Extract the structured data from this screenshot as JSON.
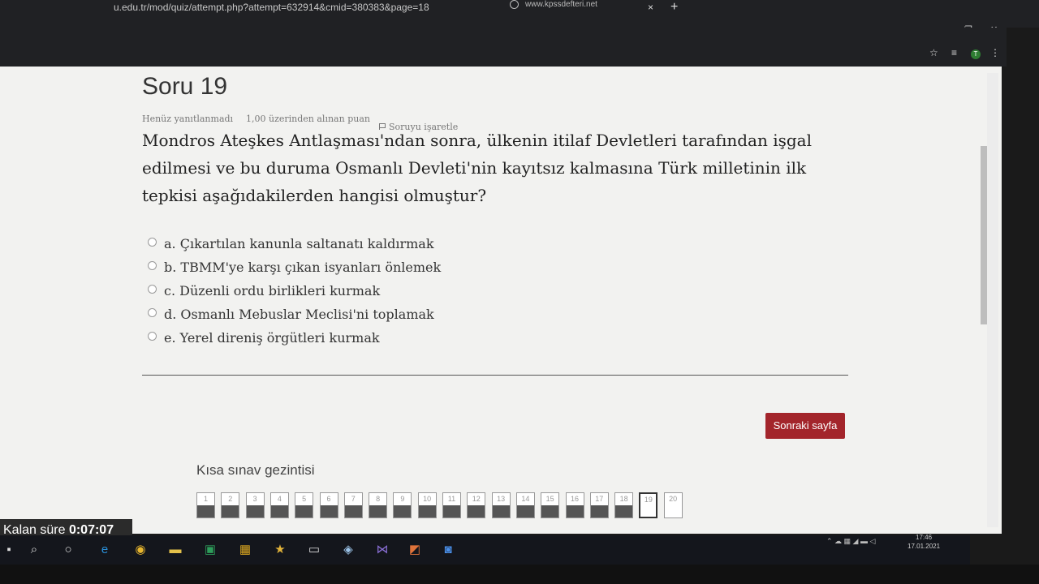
{
  "browser": {
    "url": "mod/quiz/attempt.php?attempt=632914&cmid=380383&page=18",
    "url_prefix": "u.edu.tr/",
    "tab_title": "www.kpssdefteri.net",
    "tab_close": "×",
    "new_tab": "+",
    "window_controls": [
      "–",
      "❐",
      "✕"
    ],
    "toolbar_icons": [
      "star-icon",
      "reading-list-icon",
      "profile-avatar",
      "menu-icon"
    ],
    "avatar_letter": "T"
  },
  "quiz": {
    "title": "Soru 19",
    "status": "Henüz yanıtlanmadı",
    "points": "1,00 üzerinden alınan puan",
    "flag_label": "Soruyu işaretle",
    "question_text": "Mondros Ateşkes Antlaşması'ndan sonra, ülkenin itilaf Devletleri tarafından işgal edilmesi ve bu duruma Osmanlı Devleti'nin kayıtsız kalmasına Türk milletinin ilk tepkisi aşağıdakilerden hangisi olmuştur?",
    "options": [
      "a. Çıkartılan kanunla saltanatı kaldırmak",
      "b. TBMM'ye karşı çıkan isyanları önlemek",
      "c. Düzenli ordu birlikleri kurmak",
      "d. Osmanlı Mebuslar Meclisi'ni toplamak",
      "e. Yerel direniş örgütleri kurmak"
    ],
    "next_button": "Sonraki sayfa"
  },
  "navigation": {
    "title": "Kısa sınav gezintisi",
    "buttons": [
      "1",
      "2",
      "3",
      "4",
      "5",
      "6",
      "7",
      "8",
      "9",
      "10",
      "11",
      "12",
      "13",
      "14",
      "15",
      "16",
      "17",
      "18",
      "19",
      "20"
    ],
    "current": 19
  },
  "timer": {
    "label": "Kalan süre",
    "value": "0:07:07"
  },
  "taskbar": {
    "icons": [
      "windows-icon",
      "search-icon",
      "cortana-icon",
      "edge-icon",
      "chrome-icon",
      "file-explorer-icon",
      "excel-icon",
      "photos-icon",
      "star-app-icon",
      "terminal-icon",
      "box-icon",
      "visual-studio-icon",
      "sublime-icon",
      "zoom-icon"
    ],
    "time": "17:46",
    "date": "17.01.2021"
  }
}
